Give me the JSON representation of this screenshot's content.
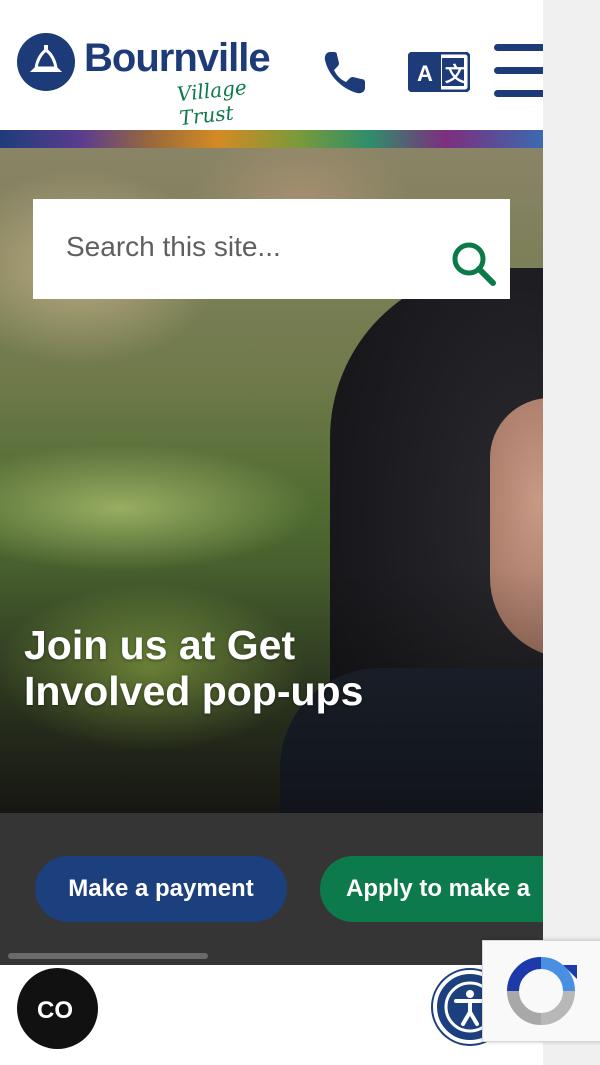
{
  "header": {
    "logo": {
      "name": "Bournville",
      "tagline": "Village Trust"
    },
    "phone_icon": "phone-icon",
    "translate_icon": "translate-icon",
    "menu_icon": "hamburger-menu-icon"
  },
  "search": {
    "placeholder": "Search this site...",
    "value": "",
    "icon": "search-icon"
  },
  "hero": {
    "title": "Join us at Get Involved pop-ups"
  },
  "quick_links": [
    {
      "label": "Make a payment",
      "color": "#1c3f7e"
    },
    {
      "label": "Apply to make a",
      "color": "#0c7a4a"
    }
  ],
  "floating": {
    "captions_icon": "closed-captions-icon",
    "accessibility_icon": "accessibility-icon",
    "recaptcha_icon": "recaptcha-icon"
  },
  "colors": {
    "brand_navy": "#1d3b78",
    "brand_green": "#0c7a48",
    "band_dark": "#353535"
  }
}
